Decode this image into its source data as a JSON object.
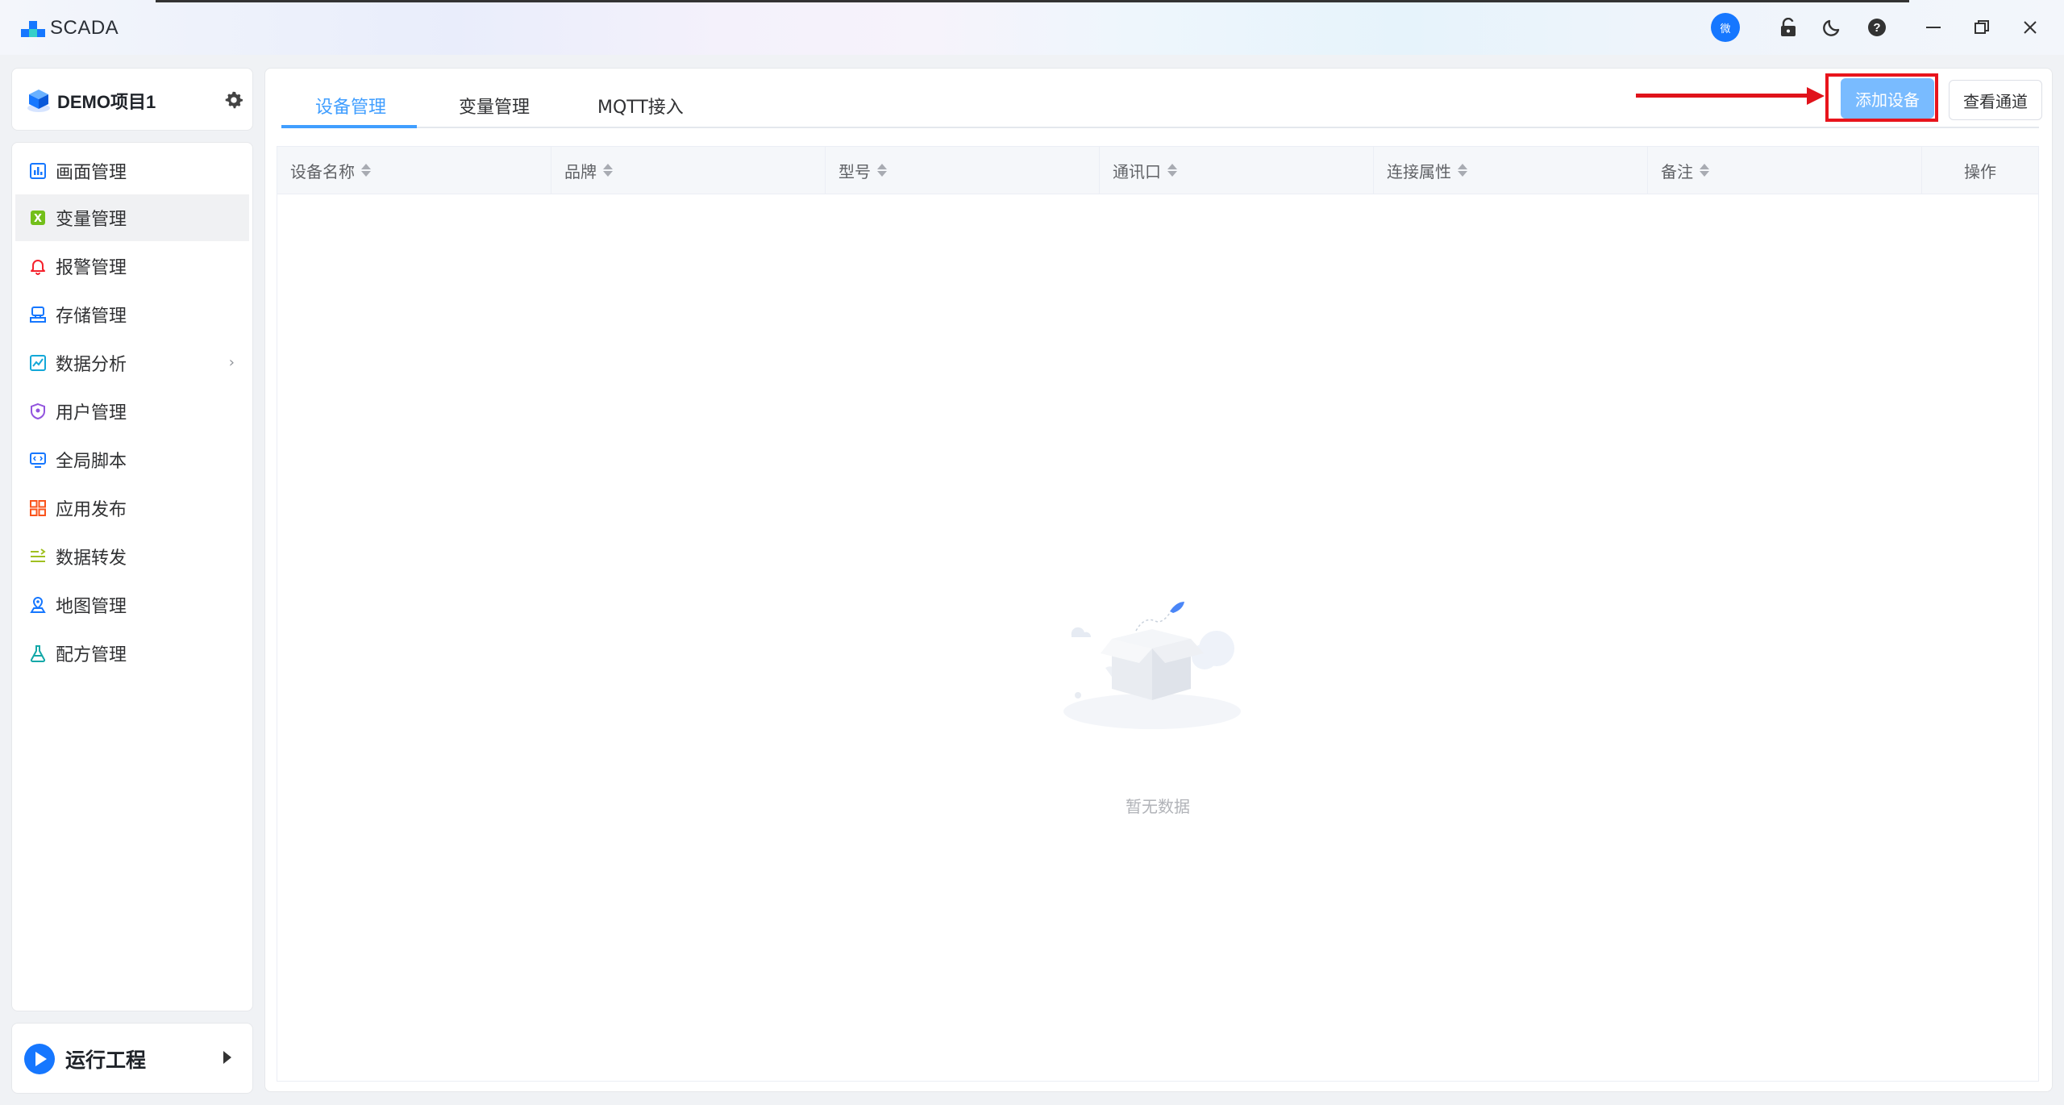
{
  "app": {
    "logo_text": "SCADA",
    "wechat_badge": "微"
  },
  "titlebar_icons": [
    "lock-icon",
    "moon-icon",
    "help-icon",
    "minimize-icon",
    "restore-icon",
    "close-icon"
  ],
  "project": {
    "name": "DEMO项目1"
  },
  "sidebar": {
    "items": [
      {
        "label": "画面管理",
        "icon": "chart-bar-icon",
        "color": "#1677ff"
      },
      {
        "label": "变量管理",
        "icon": "variable-icon",
        "color": "#52c41a"
      },
      {
        "label": "报警管理",
        "icon": "bell-icon",
        "color": "#f5222d"
      },
      {
        "label": "存储管理",
        "icon": "storage-icon",
        "color": "#1677ff"
      },
      {
        "label": "数据分析",
        "icon": "analytics-icon",
        "color": "#13a8d8",
        "has_children": true
      },
      {
        "label": "用户管理",
        "icon": "shield-user-icon",
        "color": "#9254de"
      },
      {
        "label": "全局脚本",
        "icon": "script-icon",
        "color": "#1677ff"
      },
      {
        "label": "应用发布",
        "icon": "grid-icon",
        "color": "#fa541c"
      },
      {
        "label": "数据转发",
        "icon": "forward-icon",
        "color": "#a0c020"
      },
      {
        "label": "地图管理",
        "icon": "map-icon",
        "color": "#1677ff"
      },
      {
        "label": "配方管理",
        "icon": "flask-icon",
        "color": "#13a8a8"
      }
    ],
    "active_index": 1,
    "expand_glyph": "›"
  },
  "run": {
    "label": "运行工程"
  },
  "tabs": [
    {
      "label": "设备管理",
      "active": true
    },
    {
      "label": "变量管理",
      "active": false
    },
    {
      "label": "MQTT接入",
      "active": false
    }
  ],
  "toolbar": {
    "add_device_label": "添加设备",
    "view_channel_label": "查看通道"
  },
  "table": {
    "columns": [
      "设备名称",
      "品牌",
      "型号",
      "通讯口",
      "连接属性",
      "备注",
      "操作"
    ],
    "sortable": [
      true,
      true,
      true,
      true,
      true,
      true,
      false
    ],
    "rows": [],
    "empty_text": "暂无数据"
  },
  "colors": {
    "accent": "#409eff",
    "annotation_red": "#e0131b"
  }
}
